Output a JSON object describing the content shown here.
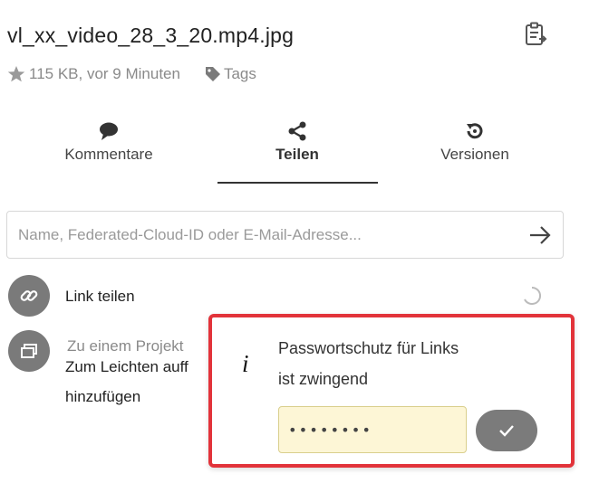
{
  "file": {
    "name": "vl_xx_video_28_3_20.mp4.jpg",
    "meta": "115 KB, vor 9 Minuten",
    "tags_label": "Tags"
  },
  "tabs": [
    {
      "label": "Kommentare",
      "icon": "comment-icon"
    },
    {
      "label": "Teilen",
      "icon": "share-icon",
      "active": true
    },
    {
      "label": "Versionen",
      "icon": "history-icon"
    }
  ],
  "share": {
    "placeholder": "Name, Federated-Cloud-ID oder E-Mail-Adresse..."
  },
  "link_share": {
    "label": "Link teilen"
  },
  "project": {
    "hint": "Zu einem Projekt",
    "line1": "Zum Leichten auff",
    "line2": "hinzufügen"
  },
  "popup": {
    "info_glyph": "i",
    "message_line1": "Passwortschutz für Links",
    "message_line2": "ist zwingend",
    "password_value": "••••••••"
  },
  "colors": {
    "accent_red": "#e2333a",
    "button_gray": "#7b7b7b",
    "password_bg": "#fdf6d6"
  }
}
